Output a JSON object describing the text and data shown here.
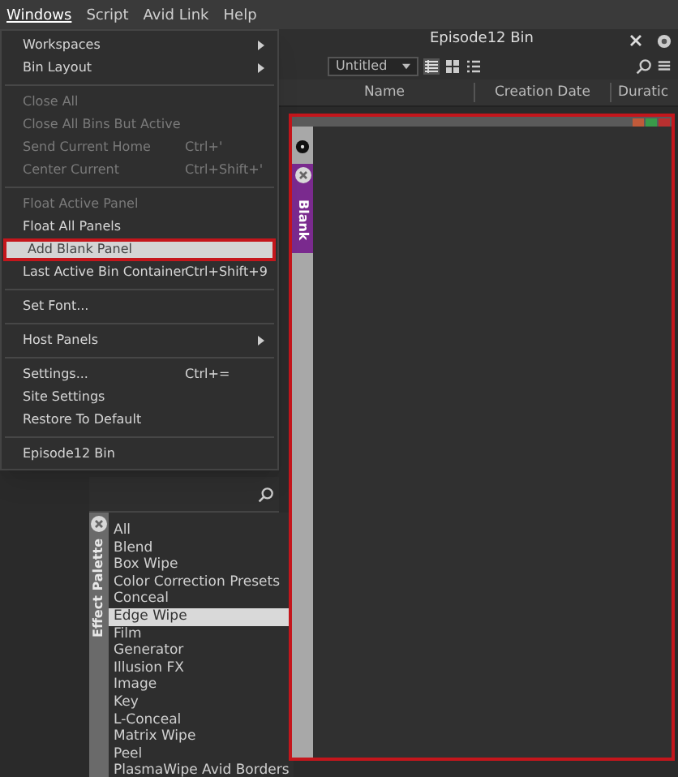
{
  "menubar": [
    {
      "label": "Windows",
      "selected": true
    },
    {
      "label": "Script",
      "selected": false
    },
    {
      "label": "Avid Link",
      "selected": false
    },
    {
      "label": "Help",
      "selected": false
    }
  ],
  "windows_menu": {
    "items": [
      {
        "kind": "item",
        "label": "Workspaces",
        "submenu": true,
        "disabled": false,
        "selected": false
      },
      {
        "kind": "item",
        "label": "Bin Layout",
        "submenu": true,
        "disabled": false,
        "selected": false
      },
      {
        "kind": "separator"
      },
      {
        "kind": "item",
        "label": "Close All",
        "disabled": true,
        "selected": false
      },
      {
        "kind": "item",
        "label": "Close All Bins But Active",
        "disabled": true,
        "selected": false
      },
      {
        "kind": "item",
        "label": "Send Current Home",
        "shortcut": "Ctrl+'",
        "disabled": true,
        "selected": false
      },
      {
        "kind": "item",
        "label": "Center Current",
        "shortcut": "Ctrl+Shift+'",
        "disabled": true,
        "selected": false
      },
      {
        "kind": "separator"
      },
      {
        "kind": "item",
        "label": "Float Active Panel",
        "disabled": true,
        "selected": false
      },
      {
        "kind": "item",
        "label": "Float All Panels",
        "disabled": false,
        "selected": false
      },
      {
        "kind": "item",
        "label": "Add Blank Panel",
        "disabled": false,
        "selected": true
      },
      {
        "kind": "item",
        "label": "Last Active Bin Container",
        "shortcut": "Ctrl+Shift+9",
        "disabled": false,
        "selected": false
      },
      {
        "kind": "separator"
      },
      {
        "kind": "item",
        "label": "Set Font...",
        "disabled": false,
        "selected": false
      },
      {
        "kind": "separator"
      },
      {
        "kind": "item",
        "label": "Host Panels",
        "submenu": true,
        "disabled": false,
        "selected": false
      },
      {
        "kind": "separator"
      },
      {
        "kind": "item",
        "label": "Settings...",
        "shortcut": "Ctrl+=",
        "disabled": false,
        "selected": false
      },
      {
        "kind": "item",
        "label": "Site Settings",
        "disabled": false,
        "selected": false
      },
      {
        "kind": "item",
        "label": "Restore To Default",
        "disabled": false,
        "selected": false
      },
      {
        "kind": "separator"
      },
      {
        "kind": "item",
        "label": "Episode12 Bin",
        "disabled": false,
        "selected": false
      }
    ]
  },
  "bin": {
    "title": "Episode12 Bin",
    "view": "Untitled",
    "columns": [
      "Name",
      "Creation Date",
      "Duratic"
    ]
  },
  "blank_panel": {
    "tab": {
      "label": "Blank",
      "selected": true
    }
  },
  "effect_palette": {
    "tab": "Effect Palette",
    "categories": [
      {
        "label": "All",
        "selected": false
      },
      {
        "label": "Blend",
        "selected": false
      },
      {
        "label": "Box Wipe",
        "selected": false
      },
      {
        "label": "Color Correction Presets",
        "selected": false
      },
      {
        "label": "Conceal",
        "selected": false
      },
      {
        "label": "Edge Wipe",
        "selected": true
      },
      {
        "label": "Film",
        "selected": false
      },
      {
        "label": "Generator",
        "selected": false
      },
      {
        "label": "Illusion FX",
        "selected": false
      },
      {
        "label": "Image",
        "selected": false
      },
      {
        "label": "Key",
        "selected": false
      },
      {
        "label": "L-Conceal",
        "selected": false
      },
      {
        "label": "Matrix Wipe",
        "selected": false
      },
      {
        "label": "Peel",
        "selected": false
      },
      {
        "label": "PlasmaWipe Avid Borders",
        "selected": false
      }
    ]
  }
}
